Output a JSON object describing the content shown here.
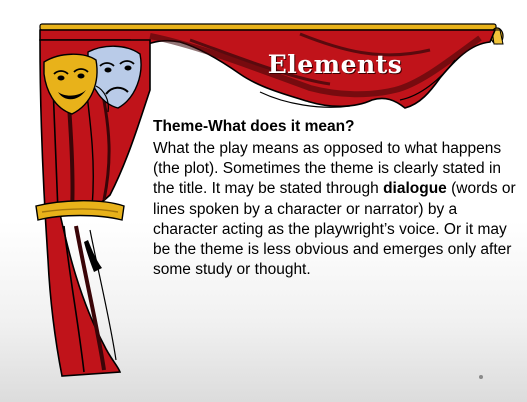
{
  "slide": {
    "title": "Elements",
    "heading": "Theme-What does it mean?",
    "body_before": "What the play means as opposed to what happens (the plot). Sometimes the theme is clearly stated in the title. It may be stated through ",
    "body_emphasis": "dialogue",
    "body_after": " (words or lines spoken by a character or narrator) by a character acting as the playwright’s voice. Or it may be the theme is less obvious and emerges only after some study or thought."
  },
  "icons": {
    "curtain": "theater-curtain-icon",
    "masks": "comedy-tragedy-masks-icon"
  },
  "colors": {
    "curtain_red": "#c0131a",
    "curtain_dark": "#5a0a0e",
    "gold": "#e8b21a",
    "tragedy_blue": "#b9cbe8"
  }
}
